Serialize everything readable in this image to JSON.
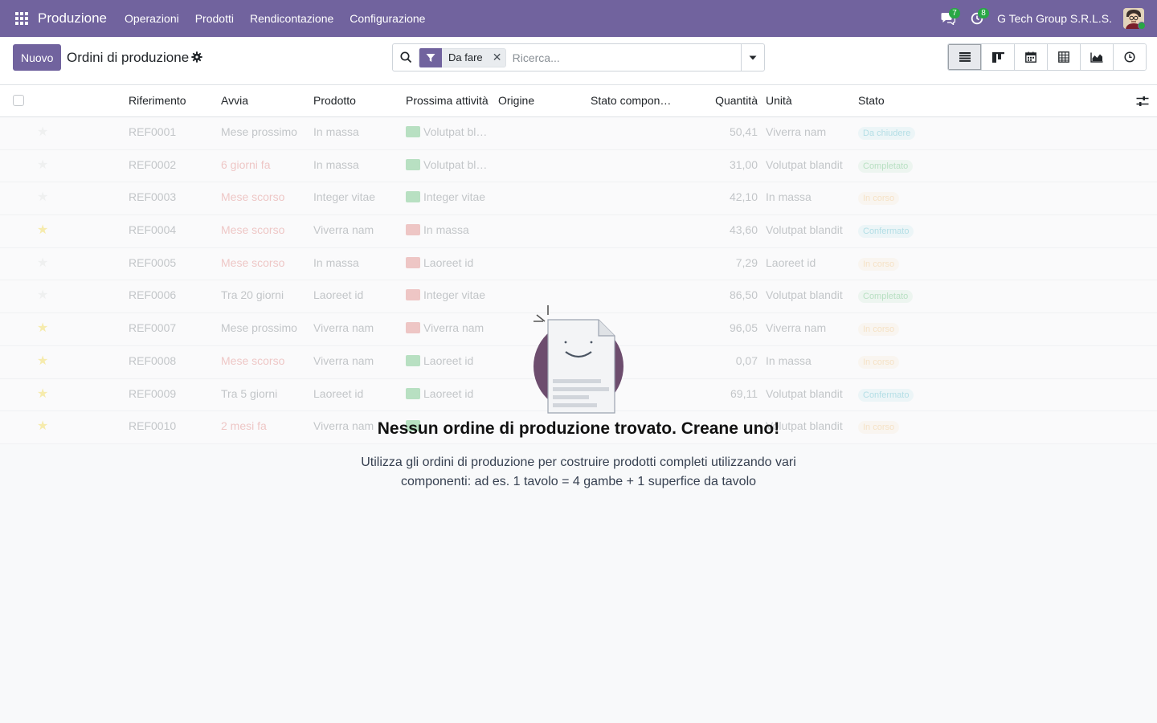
{
  "navbar": {
    "app_name": "Produzione",
    "menu": [
      "Operazioni",
      "Prodotti",
      "Rendicontazione",
      "Configurazione"
    ],
    "messages_count": "7",
    "activities_count": "8",
    "company": "G Tech Group S.R.L.S.",
    "brand_color": "#71639e"
  },
  "control": {
    "new_button": "Nuovo",
    "title": "Ordini di produzione",
    "search": {
      "facet_label": "Da fare",
      "placeholder": "Ricerca..."
    },
    "views": [
      "list-icon",
      "kanban-icon",
      "calendar-icon",
      "pivot-icon",
      "graph-icon",
      "activity-icon"
    ]
  },
  "list": {
    "headers": {
      "reference": "Riferimento",
      "start": "Avvia",
      "product": "Prodotto",
      "next_activity": "Prossima attività",
      "origin": "Origine",
      "component_status": "Stato compon…",
      "quantity": "Quantità",
      "unit": "Unità",
      "state": "Stato"
    },
    "rows": [
      {
        "starred": false,
        "ref": "REF0001",
        "start": "Mese prossimo",
        "start_overdue": false,
        "product": "In massa",
        "activity": "Volutpat bl…",
        "activity_color": "#28a745",
        "qty": "50,41",
        "unit": "Viverra nam",
        "state": "Da chiudere",
        "state_color": "#17a2b8"
      },
      {
        "starred": false,
        "ref": "REF0002",
        "start": "6 giorni fa",
        "start_overdue": true,
        "product": "In massa",
        "activity": "Volutpat bl…",
        "activity_color": "#28a745",
        "qty": "31,00",
        "unit": "Volutpat blandit",
        "state": "Completato",
        "state_color": "#28a745"
      },
      {
        "starred": false,
        "ref": "REF0003",
        "start": "Mese scorso",
        "start_overdue": true,
        "product": "Integer vitae",
        "activity": "Integer vitae",
        "activity_color": "#28a745",
        "qty": "42,10",
        "unit": "In massa",
        "state": "In corso",
        "state_color": "#f0ad4e"
      },
      {
        "starred": true,
        "ref": "REF0004",
        "start": "Mese scorso",
        "start_overdue": true,
        "product": "Viverra nam",
        "activity": "In massa",
        "activity_color": "#d9534f",
        "qty": "43,60",
        "unit": "Volutpat blandit",
        "state": "Confermato",
        "state_color": "#17a2b8"
      },
      {
        "starred": false,
        "ref": "REF0005",
        "start": "Mese scorso",
        "start_overdue": true,
        "product": "In massa",
        "activity": "Laoreet id",
        "activity_color": "#d9534f",
        "qty": "7,29",
        "unit": "Laoreet id",
        "state": "In corso",
        "state_color": "#f0ad4e"
      },
      {
        "starred": false,
        "ref": "REF0006",
        "start": "Tra 20 giorni",
        "start_overdue": false,
        "product": "Laoreet id",
        "activity": "Integer vitae",
        "activity_color": "#d9534f",
        "qty": "86,50",
        "unit": "Volutpat blandit",
        "state": "Completato",
        "state_color": "#28a745"
      },
      {
        "starred": true,
        "ref": "REF0007",
        "start": "Mese prossimo",
        "start_overdue": false,
        "product": "Viverra nam",
        "activity": "Viverra nam",
        "activity_color": "#d9534f",
        "qty": "96,05",
        "unit": "Viverra nam",
        "state": "In corso",
        "state_color": "#f0ad4e"
      },
      {
        "starred": true,
        "ref": "REF0008",
        "start": "Mese scorso",
        "start_overdue": true,
        "product": "Viverra nam",
        "activity": "Laoreet id",
        "activity_color": "#28a745",
        "qty": "0,07",
        "unit": "In massa",
        "state": "In corso",
        "state_color": "#f0ad4e"
      },
      {
        "starred": true,
        "ref": "REF0009",
        "start": "Tra 5 giorni",
        "start_overdue": false,
        "product": "Laoreet id",
        "activity": "Laoreet id",
        "activity_color": "#28a745",
        "qty": "69,11",
        "unit": "Volutpat blandit",
        "state": "Confermato",
        "state_color": "#17a2b8"
      },
      {
        "starred": true,
        "ref": "REF0010",
        "start": "2 mesi fa",
        "start_overdue": true,
        "product": "Viverra nam",
        "activity": "",
        "activity_color": "#28a745",
        "qty": "",
        "unit": "Volutpat blandit",
        "state": "In corso",
        "state_color": "#f0ad4e"
      }
    ]
  },
  "helper": {
    "title": "Nessun ordine di produzione trovato. Creane uno!",
    "text": "Utilizza gli ordini di produzione per costruire prodotti completi utilizzando vari componenti: ad es. 1 tavolo = 4 gambe + 1 superfice da tavolo"
  }
}
